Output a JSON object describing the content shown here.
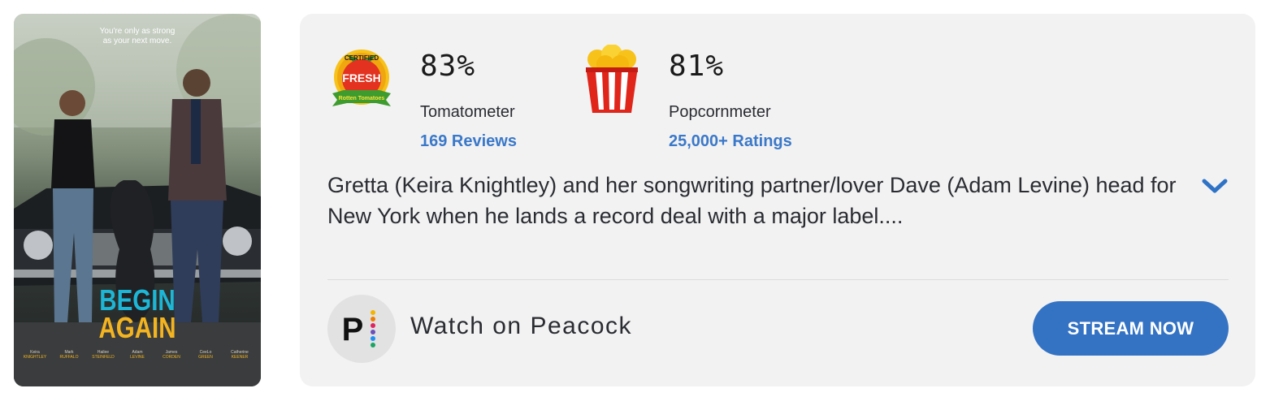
{
  "poster": {
    "tagline_line1": "You're only as strong",
    "tagline_line2": "as your next move.",
    "title_line1": "BEGIN",
    "title_line2": "AGAIN",
    "credits": [
      {
        "first": "Keira",
        "last": "KNIGHTLEY"
      },
      {
        "first": "Mark",
        "last": "RUFFALO"
      },
      {
        "first": "Hailee",
        "last": "STEINFELD"
      },
      {
        "first": "Adam",
        "last": "LEVINE"
      },
      {
        "first": "James",
        "last": "CORDEN"
      },
      {
        "first": "CeeLo",
        "last": "GREEN"
      },
      {
        "first": "Catherine",
        "last": "KEENER"
      }
    ]
  },
  "tomatometer": {
    "badge_top": "CERTIFIED",
    "badge_mid": "FRESH",
    "badge_bottom": "Rotten Tomatoes",
    "score": "83%",
    "label": "Tomatometer",
    "count_link": "169 Reviews"
  },
  "popcornmeter": {
    "score": "81%",
    "label": "Popcornmeter",
    "count_link": "25,000+ Ratings"
  },
  "synopsis": {
    "text": "Gretta (Keira Knightley) and her songwriting partner/lover Dave (Adam Levine) head for New York when he lands a record deal with a major label...."
  },
  "streaming": {
    "provider_logo_letter": "P",
    "watch_label": "Watch on Peacock",
    "button_label": "STREAM NOW"
  },
  "colors": {
    "link_blue": "#3a78c9",
    "button_blue": "#3473c4",
    "card_bg": "#f2f2f2",
    "peacock_dots": [
      "#f5b400",
      "#ef7d00",
      "#e0245e",
      "#6b4fbb",
      "#1f8ff2",
      "#19a463"
    ]
  }
}
